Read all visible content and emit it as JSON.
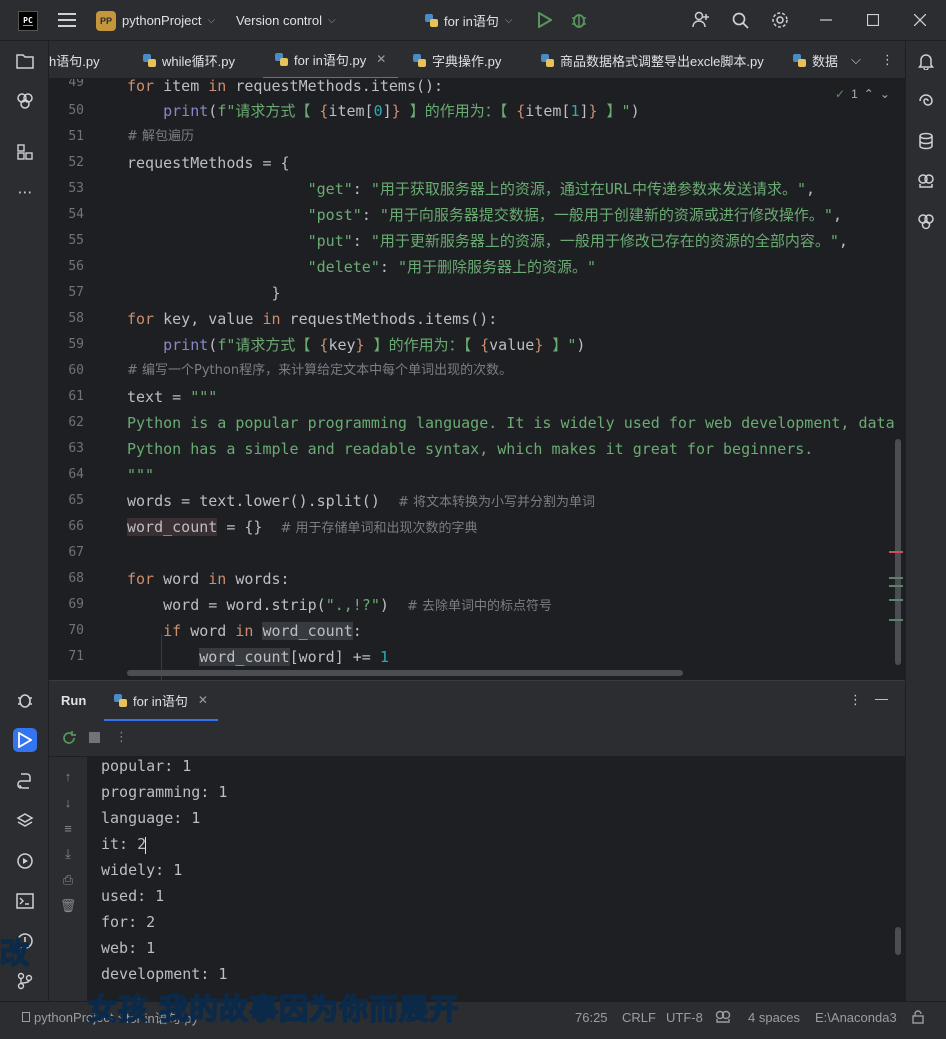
{
  "titlebar": {
    "logo_text": "PC",
    "project_badge": "PP",
    "project_name": "pythonProject",
    "vcs_label": "Version control",
    "run_config": "for in语句"
  },
  "tabs": [
    {
      "label": "h语句.py"
    },
    {
      "label": "while循环.py"
    },
    {
      "label": "for in语句.py",
      "active": true
    },
    {
      "label": "字典操作.py"
    },
    {
      "label": "商品数据格式调整导出excle脚本.py"
    },
    {
      "label": "数据"
    }
  ],
  "editor": {
    "inspection_count": "1",
    "lines": [
      {
        "n": "49",
        "text": "for item in requestMethods.items():"
      },
      {
        "n": "50",
        "text": "    print(f\"请求方式【 {item[0]} 】的作用为：【 {item[1]} 】\")"
      },
      {
        "n": "51",
        "text": "# 解包遍历"
      },
      {
        "n": "52",
        "text": "requestMethods = {"
      },
      {
        "n": "53",
        "text": "                    \"get\": \"用于获取服务器上的资源，通过在URL中传递参数来发送请求。\","
      },
      {
        "n": "54",
        "text": "                    \"post\": \"用于向服务器提交数据，一般用于创建新的资源或进行修改操作。\","
      },
      {
        "n": "55",
        "text": "                    \"put\": \"用于更新服务器上的资源，一般用于修改已存在的资源的全部内容。\","
      },
      {
        "n": "56",
        "text": "                    \"delete\": \"用于删除服务器上的资源。\""
      },
      {
        "n": "57",
        "text": "                }"
      },
      {
        "n": "58",
        "text": "for key, value in requestMethods.items():"
      },
      {
        "n": "59",
        "text": "    print(f\"请求方式【 {key} 】的作用为：【 {value} 】\")"
      },
      {
        "n": "60",
        "text": "# 编写一个Python程序，来计算给定文本中每个单词出现的次数。"
      },
      {
        "n": "61",
        "text": "text = \"\"\""
      },
      {
        "n": "62",
        "text": "Python is a popular programming language. It is widely used for web development, data s"
      },
      {
        "n": "63",
        "text": "Python has a simple and readable syntax, which makes it great for beginners."
      },
      {
        "n": "64",
        "text": "\"\"\""
      },
      {
        "n": "65",
        "text": "words = text.lower().split()  # 将文本转换为小写并分割为单词"
      },
      {
        "n": "66",
        "text": "word_count = {}  # 用于存储单词和出现次数的字典"
      },
      {
        "n": "67",
        "text": ""
      },
      {
        "n": "68",
        "text": "for word in words:"
      },
      {
        "n": "69",
        "text": "    word = word.strip(\".,!?\")  # 去除单词中的标点符号"
      },
      {
        "n": "70",
        "text": "    if word in word_count:"
      },
      {
        "n": "71",
        "text": "        word_count[word] += 1"
      }
    ]
  },
  "run": {
    "title": "Run",
    "tab_label": "for in语句",
    "output": [
      "popular: 1",
      "programming: 1",
      "language: 1",
      "it: 2",
      "widely: 1",
      "used: 1",
      "for: 2",
      "web: 1",
      "development: 1"
    ]
  },
  "statusbar": {
    "project": "pythonProject",
    "file": "for in语句.py",
    "position": "76:25",
    "line_sep": "CRLF",
    "encoding": "UTF-8",
    "indent": "4 spaces",
    "interpreter": "E:\\Anaconda3"
  },
  "subtitle": {
    "white_part": "女孩 我的故事",
    "blue_part": "因为你而展开",
    "side_char": "改"
  },
  "colors": {
    "accent": "#3574f0",
    "background": "#1e1f22",
    "panel": "#2b2d30"
  }
}
